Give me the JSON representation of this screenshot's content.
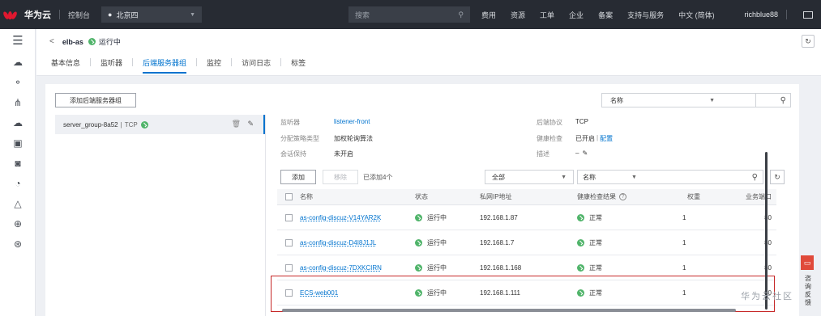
{
  "topbar": {
    "logo_text": "HUAWEI",
    "brand": "华为云",
    "console": "控制台",
    "region": "北京四",
    "search_placeholder": "搜索",
    "nav": [
      "费用",
      "资源",
      "工单",
      "企业",
      "备案",
      "支持与服务",
      "中文 (简体)"
    ],
    "user": "richblue88"
  },
  "rail": {
    "icons": [
      "menu-icon",
      "cloud-service-icon",
      "network-icon",
      "elb-icon",
      "storage-icon",
      "database-icon",
      "security-icon",
      "monitor-icon",
      "alert-icon",
      "globe-icon",
      "settings-icon"
    ]
  },
  "header": {
    "back": "<",
    "name": "elb-as",
    "status": "运行中",
    "tabs": [
      "基本信息",
      "监听器",
      "后端服务器组",
      "监控",
      "访问日志",
      "标签"
    ],
    "active_tab": "后端服务器组"
  },
  "card": {
    "add_group_button": "添加后端服务器组",
    "filter_select": "名称",
    "group": {
      "name": "server_group-8a52",
      "protocol": "TCP"
    },
    "details": {
      "listener_label": "监听器",
      "listener_value": "listener-front",
      "algo_label": "分配策略类型",
      "algo_value": "加权轮询算法",
      "session_label": "会话保持",
      "session_value": "未开启",
      "protocol_label": "后端协议",
      "protocol_value": "TCP",
      "health_label": "健康检查",
      "health_value_on": "已开启",
      "health_sep": "|",
      "health_config": "配置",
      "desc_label": "描述",
      "desc_value": "–"
    },
    "toolbar": {
      "add": "添加",
      "remove": "移除",
      "added": "已添加4个",
      "all": "全部",
      "name_select": "名称"
    },
    "table": {
      "headers": [
        "名称",
        "状态",
        "私网IP地址",
        "健康检查结果",
        "权重",
        "业务端口"
      ],
      "rows": [
        {
          "name": "as-config-discuz-V14YAR2K",
          "status": "运行中",
          "ip": "192.168.1.87",
          "health": "正常",
          "weight": "1",
          "port": "80"
        },
        {
          "name": "as-config-discuz-D4I8J1JL",
          "status": "运行中",
          "ip": "192.168.1.7",
          "health": "正常",
          "weight": "1",
          "port": "80"
        },
        {
          "name": "as-config-discuz-7DXKCIRN",
          "status": "运行中",
          "ip": "192.168.1.168",
          "health": "正常",
          "weight": "1",
          "port": "80"
        },
        {
          "name": "ECS-web001",
          "status": "运行中",
          "ip": "192.168.1.111",
          "health": "正常",
          "weight": "1",
          "port": "80"
        }
      ]
    }
  },
  "float": {
    "consult": "咨询反馈",
    "watermark": "华为云社区"
  },
  "colors": {
    "topbar": "#272b33",
    "accent": "#0073ce",
    "running": "#50b46a",
    "highlight": "#c62828"
  }
}
